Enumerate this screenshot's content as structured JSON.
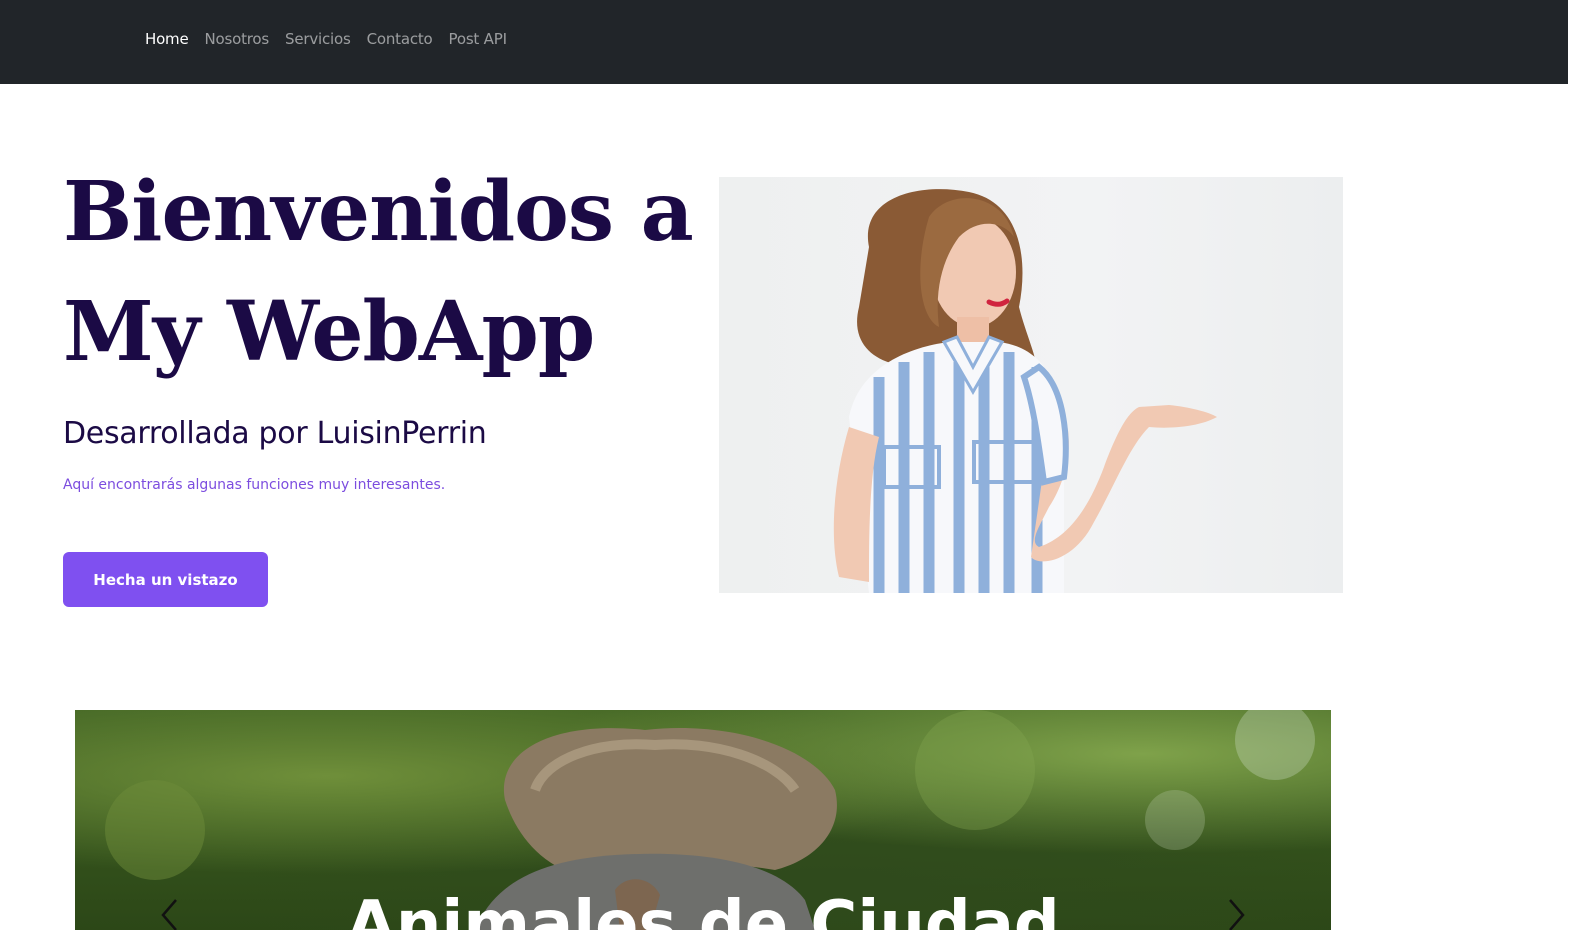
{
  "nav": {
    "items": [
      {
        "label": "Home",
        "active": true
      },
      {
        "label": "Nosotros",
        "active": false
      },
      {
        "label": "Servicios",
        "active": false
      },
      {
        "label": "Contacto",
        "active": false
      },
      {
        "label": "Post API",
        "active": false
      }
    ]
  },
  "hero": {
    "title_line1": "Bienvenidos a",
    "title_line2": "My WebApp",
    "subtitle": "Desarrollada por LuisinPerrin",
    "text": "Aquí encontrarás algunas funciones muy interesantes.",
    "button_label": "Hecha un vistazo",
    "image": "woman-presenting-photo"
  },
  "carousel": {
    "caption": "Animales de Ciudad",
    "image": "squirrel-photo",
    "prev_icon": "chevron-left-icon",
    "next_icon": "chevron-right-icon"
  },
  "colors": {
    "navbar_bg": "#212529",
    "heading": "#1b0a45",
    "accent": "#7f50f0",
    "accent_text": "#7c4ddf"
  }
}
